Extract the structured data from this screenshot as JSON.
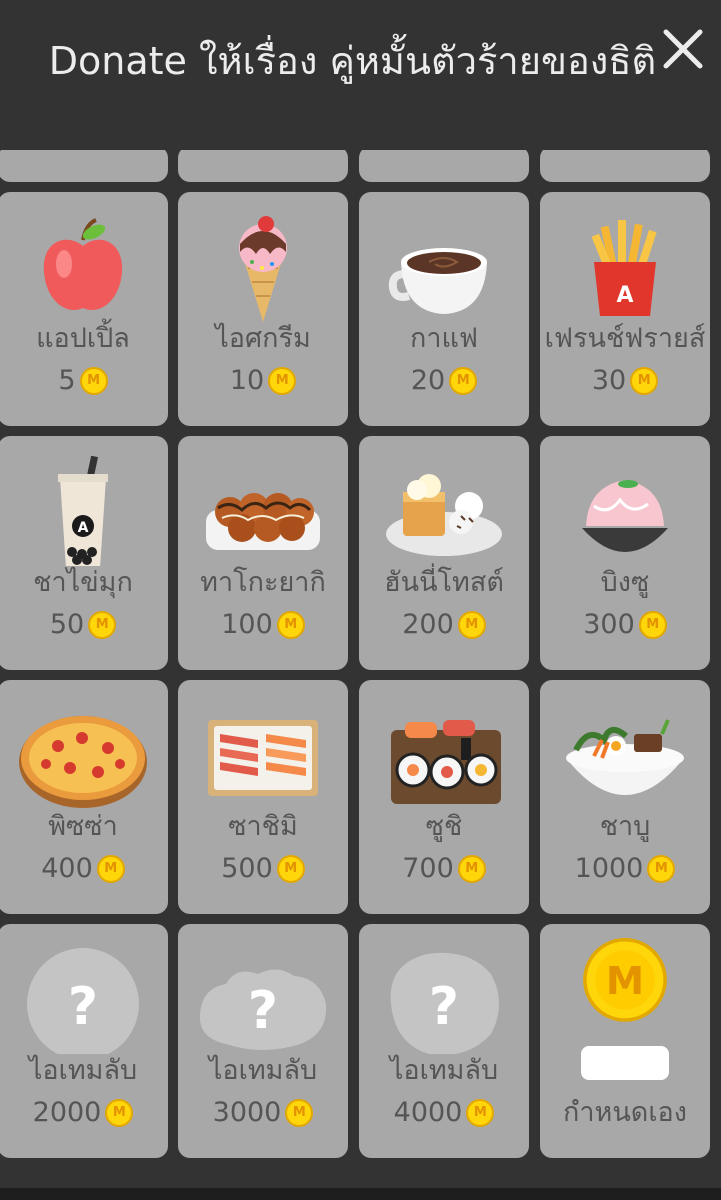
{
  "header": {
    "title": "Donate ให้เรื่อง  คู่หมั้นตัวร้ายของธิติ",
    "close_label": "✕"
  },
  "coin_label": "M",
  "items": [
    {
      "name": "แอปเปิ้ล",
      "price": "5",
      "icon": "apple-icon"
    },
    {
      "name": "ไอศกรีม",
      "price": "10",
      "icon": "ice-cream-icon"
    },
    {
      "name": "กาแฟ",
      "price": "20",
      "icon": "coffee-icon"
    },
    {
      "name": "เฟรนช์ฟรายส์",
      "price": "30",
      "icon": "fries-icon"
    },
    {
      "name": "ชาไข่มุก",
      "price": "50",
      "icon": "bubble-tea-icon"
    },
    {
      "name": "ทาโกะยากิ",
      "price": "100",
      "icon": "takoyaki-icon"
    },
    {
      "name": "ฮันนี่โทสต์",
      "price": "200",
      "icon": "honey-toast-icon"
    },
    {
      "name": "บิงซู",
      "price": "300",
      "icon": "bingsu-icon"
    },
    {
      "name": "พิซซ่า",
      "price": "400",
      "icon": "pizza-icon"
    },
    {
      "name": "ซาชิมิ",
      "price": "500",
      "icon": "sashimi-icon"
    },
    {
      "name": "ซูชิ",
      "price": "700",
      "icon": "sushi-icon"
    },
    {
      "name": "ชาบู",
      "price": "1000",
      "icon": "shabu-icon"
    },
    {
      "name": "ไอเทมลับ",
      "price": "2000",
      "icon": "secret-item-icon"
    },
    {
      "name": "ไอเทมลับ",
      "price": "3000",
      "icon": "secret-item-icon"
    },
    {
      "name": "ไอเทมลับ",
      "price": "4000",
      "icon": "secret-item-icon"
    }
  ],
  "custom": {
    "label": "กำหนดเอง",
    "icon": "coin-icon",
    "coin_label": "M"
  },
  "colors": {
    "background": "#333333",
    "card": "#a8a8a8",
    "text": "#555555",
    "coin": "#ffd60a",
    "header_text": "#ececec"
  }
}
